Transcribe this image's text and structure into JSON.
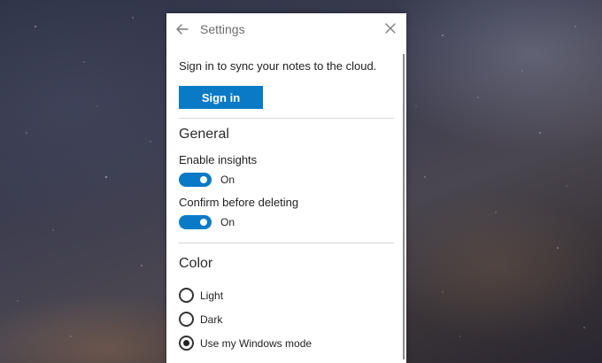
{
  "window": {
    "title": "Settings",
    "back_icon": "back-arrow-icon",
    "close_icon": "close-icon"
  },
  "account": {
    "prompt": "Sign in to sync your notes to the cloud.",
    "signin_label": "Sign in"
  },
  "general": {
    "heading": "General",
    "insights_label": "Enable insights",
    "insights_state": "On",
    "confirm_label": "Confirm before deleting",
    "confirm_state": "On"
  },
  "color": {
    "heading": "Color",
    "options": [
      {
        "label": "Light",
        "selected": false
      },
      {
        "label": "Dark",
        "selected": false
      },
      {
        "label": "Use my Windows mode",
        "selected": true
      }
    ]
  },
  "colors": {
    "accent": "#0A7AC6",
    "panel_background": "#FFFFFF"
  }
}
